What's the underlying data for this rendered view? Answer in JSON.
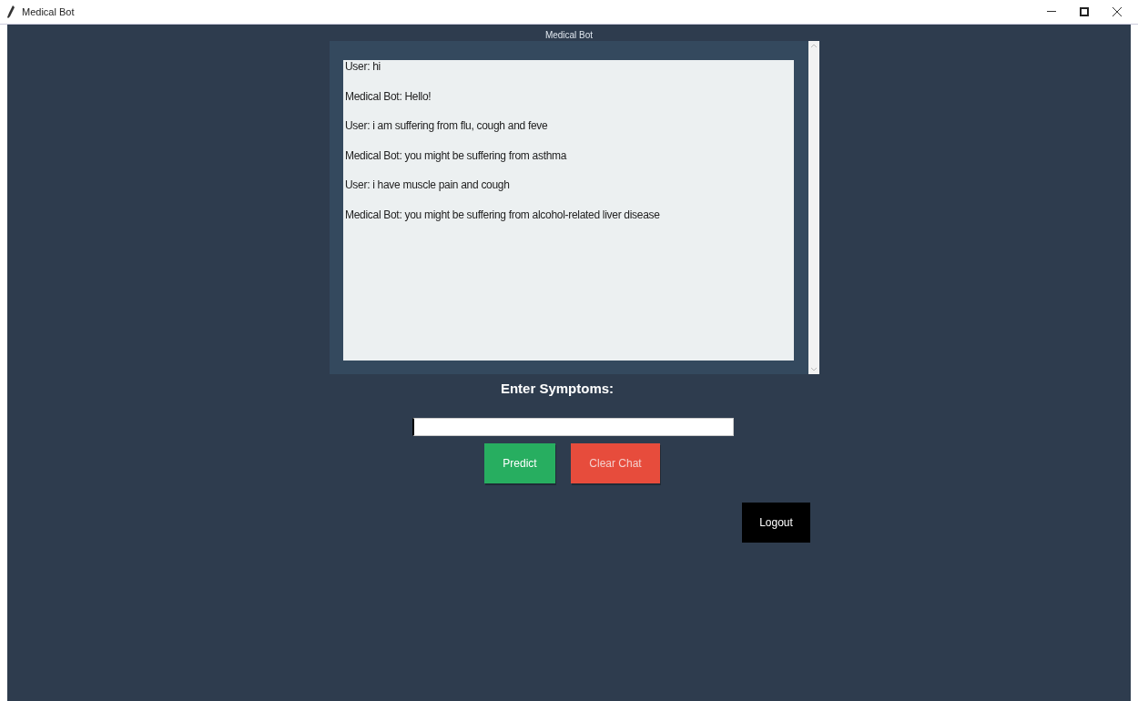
{
  "window": {
    "title": "Medical Bot"
  },
  "chat": {
    "title": "Medical Bot",
    "messages": [
      {
        "text": "User: hi"
      },
      {
        "text": "Medical Bot: Hello!"
      },
      {
        "text": "User: i am suffering from flu, cough and feve"
      },
      {
        "text": "Medical Bot: you might be suffering from asthma"
      },
      {
        "text": "User: i have muscle pain and cough"
      },
      {
        "text": "Medical Bot: you might be suffering from alcohol-related liver disease"
      }
    ]
  },
  "symptoms": {
    "label": "Enter Symptoms:"
  },
  "buttons": [
    {
      "label": "Predict",
      "kind": "predict"
    },
    {
      "label": "Clear Chat",
      "kind": "clear"
    }
  ],
  "logout": {
    "label": "Logout"
  }
}
